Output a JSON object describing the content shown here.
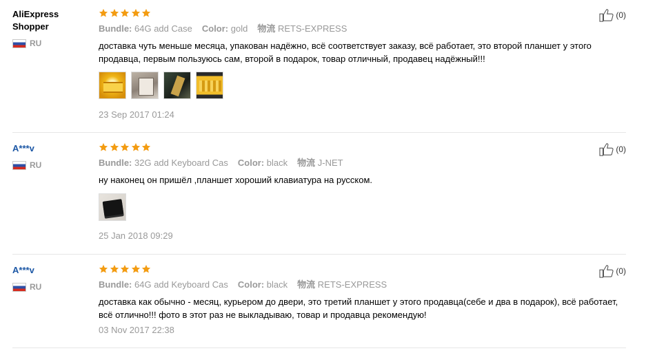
{
  "colors": {
    "star": "#f39c12",
    "masked_user": "#1c57a5",
    "meta_gray": "#999999",
    "divider": "#e6e6e6"
  },
  "icons": {
    "star": "star-icon",
    "like": "thumbs-up-icon",
    "flag": "russia-flag-icon"
  },
  "reviews": [
    {
      "user_line1": "AliExpress",
      "user_line2": "Shopper",
      "country": "RU",
      "rating": 5,
      "bundle_key": "Bundle:",
      "bundle_val": "64G add Case",
      "color_key": "Color:",
      "color_val": "gold",
      "shipping_key": "物流",
      "shipping_val": "RETS-EXPRESS",
      "text": "доставка чуть меньше месяца, упакован надёжно, всё соответствует заказу, всё работает, это второй планшет у этого продавца, первым пользуюсь сам, второй в подарок, товар отличный, продавец надёжный!!!",
      "date": "23 Sep 2017 01:24",
      "likes": "(0)"
    },
    {
      "user_line1": "A***v",
      "country": "RU",
      "rating": 5,
      "bundle_key": "Bundle:",
      "bundle_val": "32G add Keyboard Cas",
      "color_key": "Color:",
      "color_val": "black",
      "shipping_key": "物流",
      "shipping_val": "J-NET",
      "text": "ну наконец он пришёл ,планшет хороший клавиатура на русском.",
      "date": "25 Jan 2018 09:29",
      "likes": "(0)"
    },
    {
      "user_line1": "A***v",
      "country": "RU",
      "rating": 5,
      "bundle_key": "Bundle:",
      "bundle_val": "64G add Keyboard Cas",
      "color_key": "Color:",
      "color_val": "black",
      "shipping_key": "物流",
      "shipping_val": "RETS-EXPRESS",
      "text": "доставка как обычно - месяц, курьером до двери, это третий планшет у этого продавца(себе и два в подарок), всё работает, всё отлично!!! фото в этот раз не выкладываю, товар и продавца рекомендую!",
      "date": "03 Nov 2017 22:38",
      "likes": "(0)"
    }
  ]
}
